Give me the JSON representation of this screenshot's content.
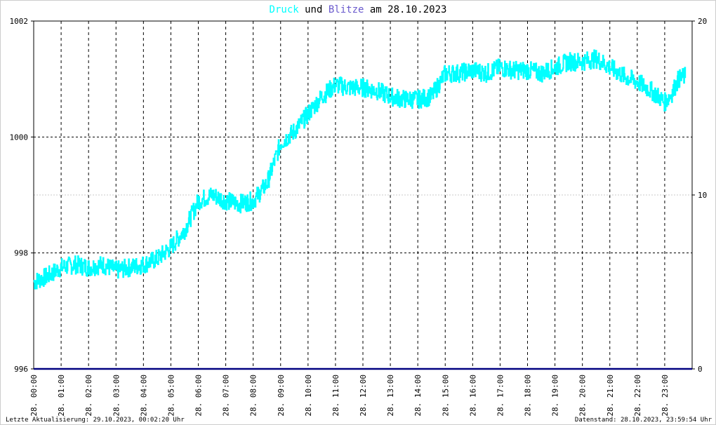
{
  "chart_data": {
    "type": "line",
    "title": {
      "part1": "Druck",
      "part2": " und ",
      "part3": "Blitze",
      "part4": " am 28.10.2023"
    },
    "colors": {
      "pressure": "#00ffff",
      "lightning": "#000080",
      "title_dark": "#000000",
      "title_blitze": "#6a5acd"
    },
    "x_tick_labels": [
      "28. 00:00",
      "28. 01:00",
      "28. 02:00",
      "28. 03:00",
      "28. 04:00",
      "28. 05:00",
      "28. 06:00",
      "28. 07:00",
      "28. 08:00",
      "28. 09:00",
      "28. 10:00",
      "28. 11:00",
      "28. 12:00",
      "28. 13:00",
      "28. 14:00",
      "28. 15:00",
      "28. 16:00",
      "28. 17:00",
      "28. 18:00",
      "28. 19:00",
      "28. 20:00",
      "28. 21:00",
      "28. 22:00",
      "28. 23:00"
    ],
    "y_left": {
      "range": [
        996,
        1002
      ],
      "ticks": [
        "996",
        "998",
        "1000",
        "1002"
      ]
    },
    "y_right": {
      "range": [
        0,
        20
      ],
      "ticks": [
        "0",
        "10",
        "20"
      ]
    },
    "grid": true,
    "series": [
      {
        "x": [
          0,
          0.5,
          1,
          1.5,
          2,
          2.5,
          3,
          3.5,
          4,
          4.5,
          5,
          5.5,
          6,
          6.5,
          7,
          7.5,
          8,
          8.5,
          9,
          9.5,
          10,
          10.5,
          11,
          11.5,
          12,
          12.5,
          13,
          13.5,
          14,
          14.5,
          15,
          15.5,
          16,
          16.5,
          17,
          17.5,
          18,
          18.5,
          19,
          19.5,
          20,
          20.5,
          21,
          21.5,
          22,
          22.5,
          23,
          23.25,
          23.5,
          23.75
        ],
        "values": [
          997.5,
          997.6,
          997.75,
          997.8,
          997.75,
          997.8,
          997.7,
          997.75,
          997.8,
          997.9,
          998.1,
          998.4,
          998.9,
          999.0,
          998.9,
          998.85,
          998.9,
          999.2,
          999.9,
          1000.1,
          1000.4,
          1000.7,
          1000.9,
          1000.85,
          1000.85,
          1000.8,
          1000.7,
          1000.65,
          1000.65,
          1000.7,
          1001.1,
          1001.1,
          1001.15,
          1001.1,
          1001.2,
          1001.15,
          1001.15,
          1001.1,
          1001.2,
          1001.3,
          1001.3,
          1001.35,
          1001.2,
          1001.05,
          1000.95,
          1000.8,
          1000.6,
          1000.75,
          1001.0,
          1001.05
        ]
      },
      {
        "x": [
          0,
          24
        ],
        "values": [
          0,
          0
        ]
      }
    ]
  },
  "footer": {
    "left": "Letzte Aktualisierung: 29.10.2023, 00:02:20 Uhr",
    "right": "Datenstand: 28.10.2023, 23:59:54 Uhr"
  }
}
